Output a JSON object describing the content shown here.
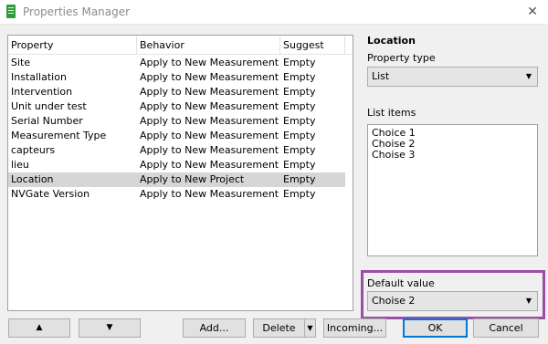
{
  "window": {
    "title": "Properties Manager",
    "close_glyph": "✕",
    "app_icon": "spreadsheet-icon"
  },
  "table": {
    "headers": [
      "Property",
      "Behavior",
      "Suggest"
    ],
    "rows": [
      [
        "Site",
        "Apply to New Measurement",
        "Empty"
      ],
      [
        "Installation",
        "Apply to New Measurement",
        "Empty"
      ],
      [
        "Intervention",
        "Apply to New Measurement",
        "Empty"
      ],
      [
        "Unit under test",
        "Apply to New Measurement",
        "Empty"
      ],
      [
        "Serial Number",
        "Apply to New Measurement",
        "Empty"
      ],
      [
        "Measurement Type",
        "Apply to New Measurement",
        "Empty"
      ],
      [
        "capteurs",
        "Apply to New Measurement",
        "Empty"
      ],
      [
        "lieu",
        "Apply to New Measurement",
        "Empty"
      ],
      [
        "Location",
        "Apply to New Project",
        "Empty"
      ],
      [
        "NVGate Version",
        "Apply to New Measurement",
        "Empty"
      ]
    ],
    "selected_row": 8
  },
  "detail": {
    "title": "Location",
    "property_type_label": "Property type",
    "property_type_value": "List",
    "list_items_label": "List items",
    "list_items": [
      "Choice 1",
      "Choise 2",
      "Choise 3"
    ],
    "default_value_label": "Default value",
    "default_value": "Choise 2"
  },
  "buttons": {
    "move_up": "▲",
    "move_down": "▼",
    "add": "Add...",
    "delete": "Delete",
    "delete_menu_arrow": "▼",
    "incoming": "Incoming...",
    "ok": "OK",
    "cancel": "Cancel"
  },
  "colors": {
    "selection": "#d6d6d6",
    "highlight_frame": "#9b4ea5",
    "default_button_border": "#0078d7"
  }
}
